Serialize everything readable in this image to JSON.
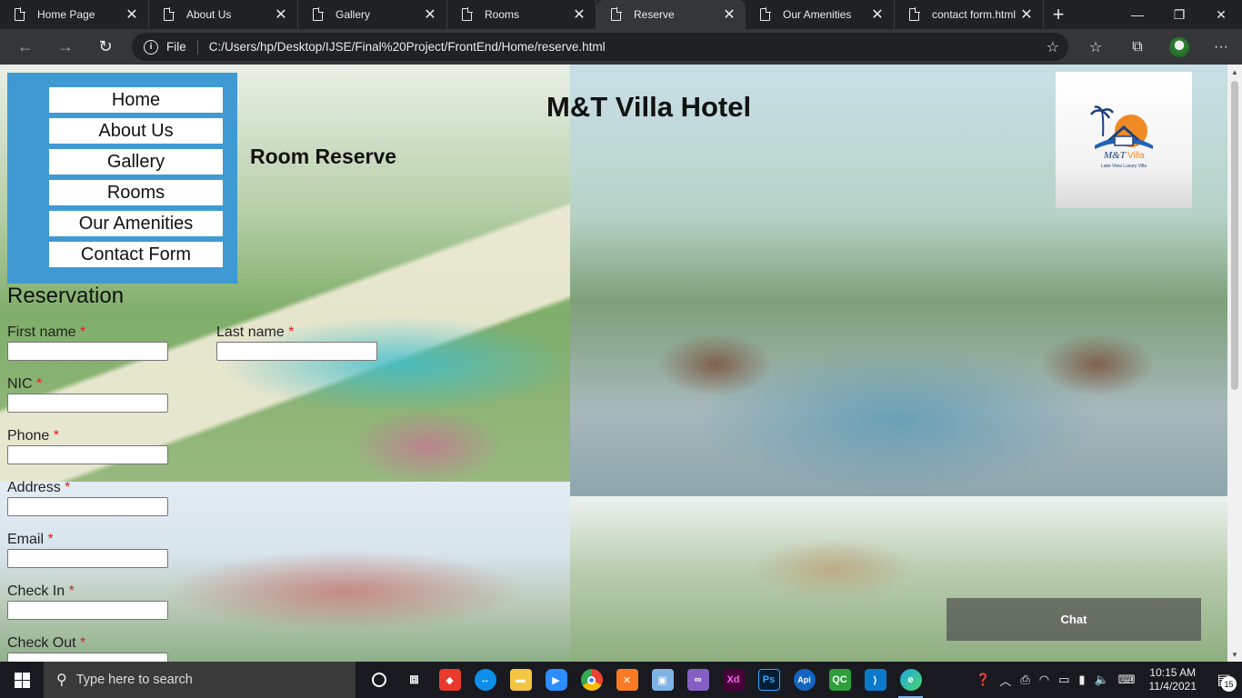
{
  "browser": {
    "tabs": [
      {
        "title": "Home Page",
        "active": false
      },
      {
        "title": "About Us",
        "active": false
      },
      {
        "title": "Gallery",
        "active": false
      },
      {
        "title": "Rooms",
        "active": false
      },
      {
        "title": "Reserve",
        "active": true
      },
      {
        "title": "Our Amenities",
        "active": false
      },
      {
        "title": "contact form.html",
        "active": false
      }
    ],
    "address": {
      "scheme_label": "File",
      "url": "C:/Users/hp/Desktop/IJSE/Final%20Project/FrontEnd/Home/reserve.html"
    }
  },
  "page": {
    "hotel_title": "M&T Villa Hotel",
    "subtitle": "Room Reserve",
    "menu": [
      "Home",
      "About Us",
      "Gallery",
      "Rooms",
      "Our Amenities",
      "Contact Form"
    ],
    "logo": {
      "brand": "M&T",
      "brand2": "Villa",
      "tagline": "Lake View Luxury Villa"
    },
    "form": {
      "title": "Reservation",
      "required_mark": "*",
      "fields": {
        "first_name": "First name",
        "last_name": "Last name",
        "nic": "NIC",
        "phone": "Phone",
        "address": "Address",
        "email": "Email",
        "check_in": "Check In",
        "check_out": "Check Out"
      }
    },
    "chat_label": "Chat"
  },
  "taskbar": {
    "search_placeholder": "Type here to search",
    "time": "10:15 AM",
    "date": "11/4/2021",
    "notification_count": "15"
  },
  "colors": {
    "menu_bg": "#3f9ad3",
    "required": "#e02020",
    "tab_bar": "#202124",
    "toolbar": "#35363a"
  }
}
